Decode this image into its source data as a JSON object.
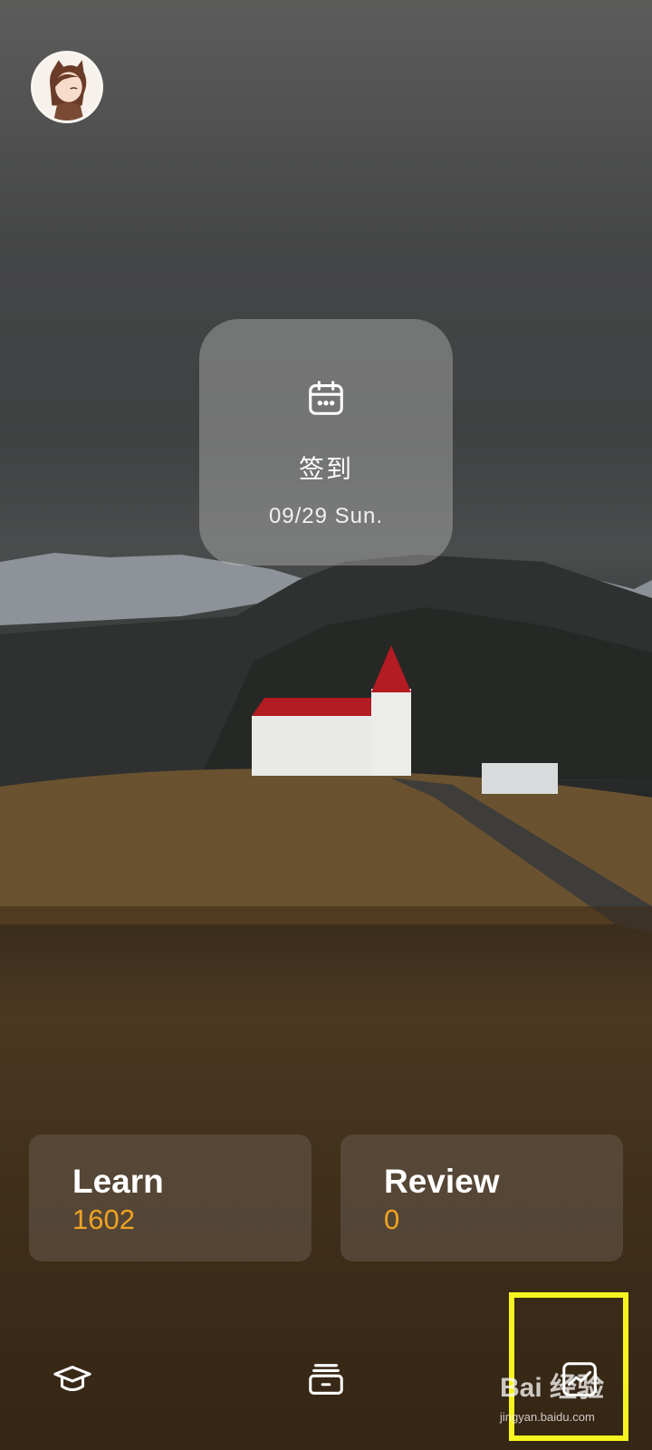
{
  "checkin": {
    "title": "签到",
    "date": "09/29 Sun."
  },
  "cards": {
    "learn": {
      "label": "Learn",
      "count": "1602"
    },
    "review": {
      "label": "Review",
      "count": "0"
    }
  },
  "nav": [
    {
      "icon": "graduation-cap-icon"
    },
    {
      "icon": "archive-box-icon"
    },
    {
      "icon": "trend-chart-icon"
    }
  ],
  "watermark": {
    "brand": "Bai 经验",
    "url": "jingyan.baidu.com"
  },
  "colors": {
    "accent": "#f0a321",
    "highlight": "#f6f41e"
  }
}
